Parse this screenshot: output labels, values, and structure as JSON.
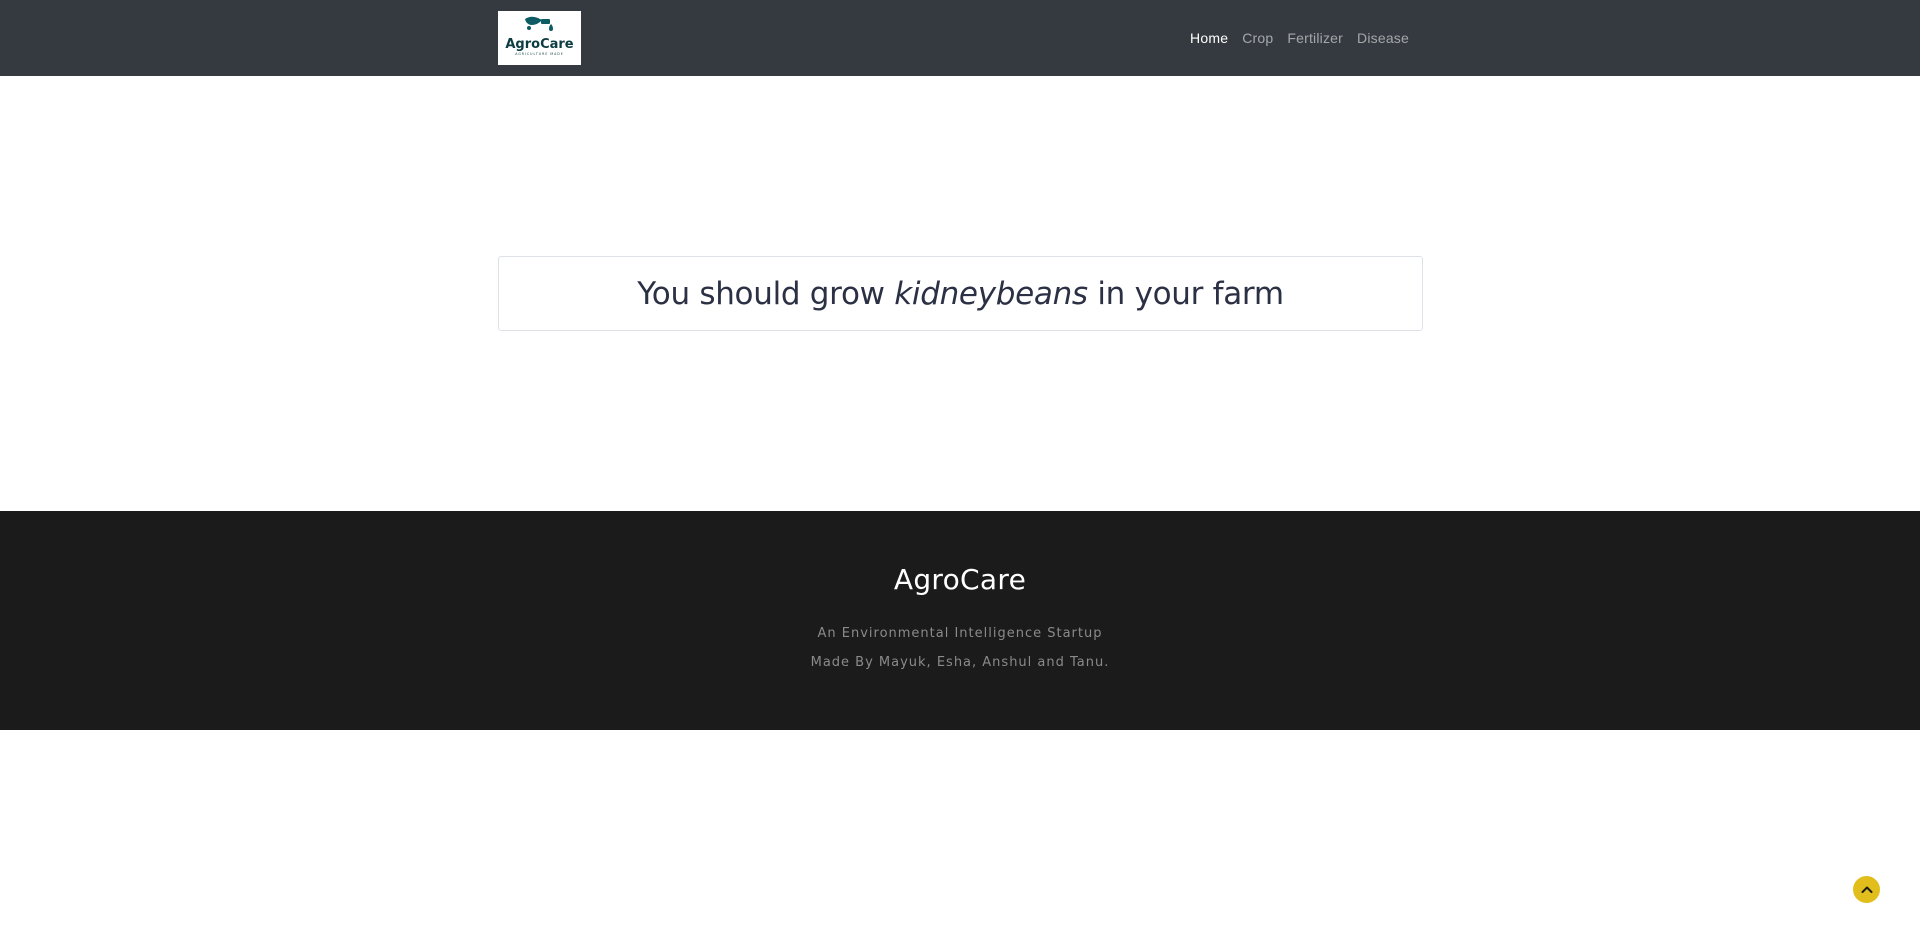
{
  "navbar": {
    "logo": {
      "text": "AgroCare",
      "tagline": "AGRICULTURE MADE",
      "alt": "AgroCare logo"
    },
    "links": [
      {
        "label": "Home",
        "active": true
      },
      {
        "label": "Crop",
        "active": false
      },
      {
        "label": "Fertilizer",
        "active": false
      },
      {
        "label": "Disease",
        "active": false
      }
    ]
  },
  "result": {
    "prefix": "You should grow ",
    "crop": "kidneybeans",
    "suffix": " in your farm"
  },
  "footer": {
    "title": "AgroCare",
    "line1": "An Environmental Intelligence Startup",
    "line2": "Made By Mayuk, Esha, Anshul and Tanu."
  },
  "back_to_top": {
    "icon": "chevron-up-icon"
  },
  "colors": {
    "navbar_bg": "#343a40",
    "footer_bg": "#1b1b1b",
    "accent": "#e1be1c",
    "logo_teal": "#0e5c63"
  }
}
